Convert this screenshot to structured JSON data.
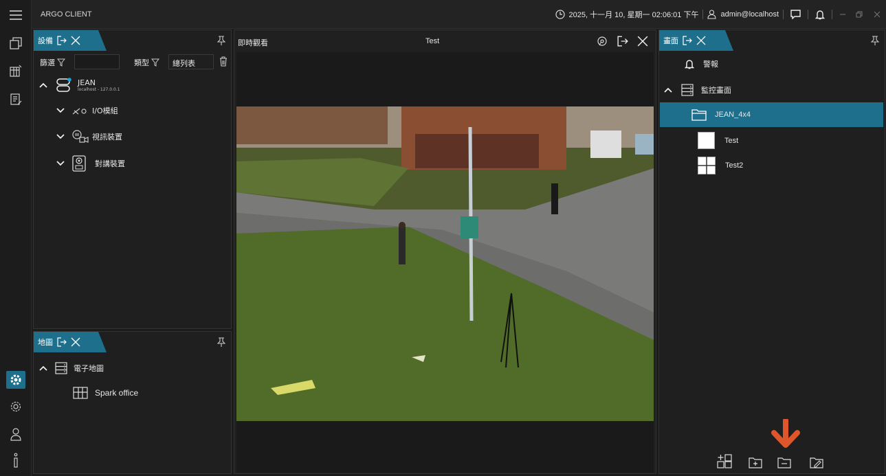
{
  "app": {
    "title": "ARGO CLIENT"
  },
  "status": {
    "datetime": "2025, 十一月 10, 星期一 02:06:01 下午",
    "user": "admin@localhost"
  },
  "device_panel": {
    "tab_label": "設備",
    "filter_label": "篩選",
    "filter_value": "",
    "type_label": "類型",
    "type_value": "總列表",
    "tree": {
      "server_name": "JEAN",
      "server_host": "localhost - 127.0.0.1",
      "groups": [
        "I/O模組",
        "視訊裝置",
        "對講裝置"
      ]
    }
  },
  "map_panel": {
    "tab_label": "地圖",
    "root_label": "電子地圖",
    "items": [
      "Spark office"
    ]
  },
  "live_view": {
    "title": "即時觀看",
    "layout_name": "Test"
  },
  "screen_panel": {
    "tab_label": "畫面",
    "alarm_label": "警報",
    "root_label": "監控畫面",
    "folder": "JEAN_4x4",
    "views": [
      "Test",
      "Test2"
    ]
  },
  "icons": {
    "menu": "hamburger-icon",
    "clock": "clock-icon",
    "user": "user-icon",
    "chat": "chat-icon",
    "bell": "bell-icon",
    "pin": "pin-icon",
    "close": "close-icon",
    "detach": "detach-icon",
    "trash": "trash-icon"
  },
  "colors": {
    "accent": "#1e6f8c",
    "arrow": "#e0562b",
    "background": "#1b1b1b",
    "panel": "#1f1f1f"
  }
}
